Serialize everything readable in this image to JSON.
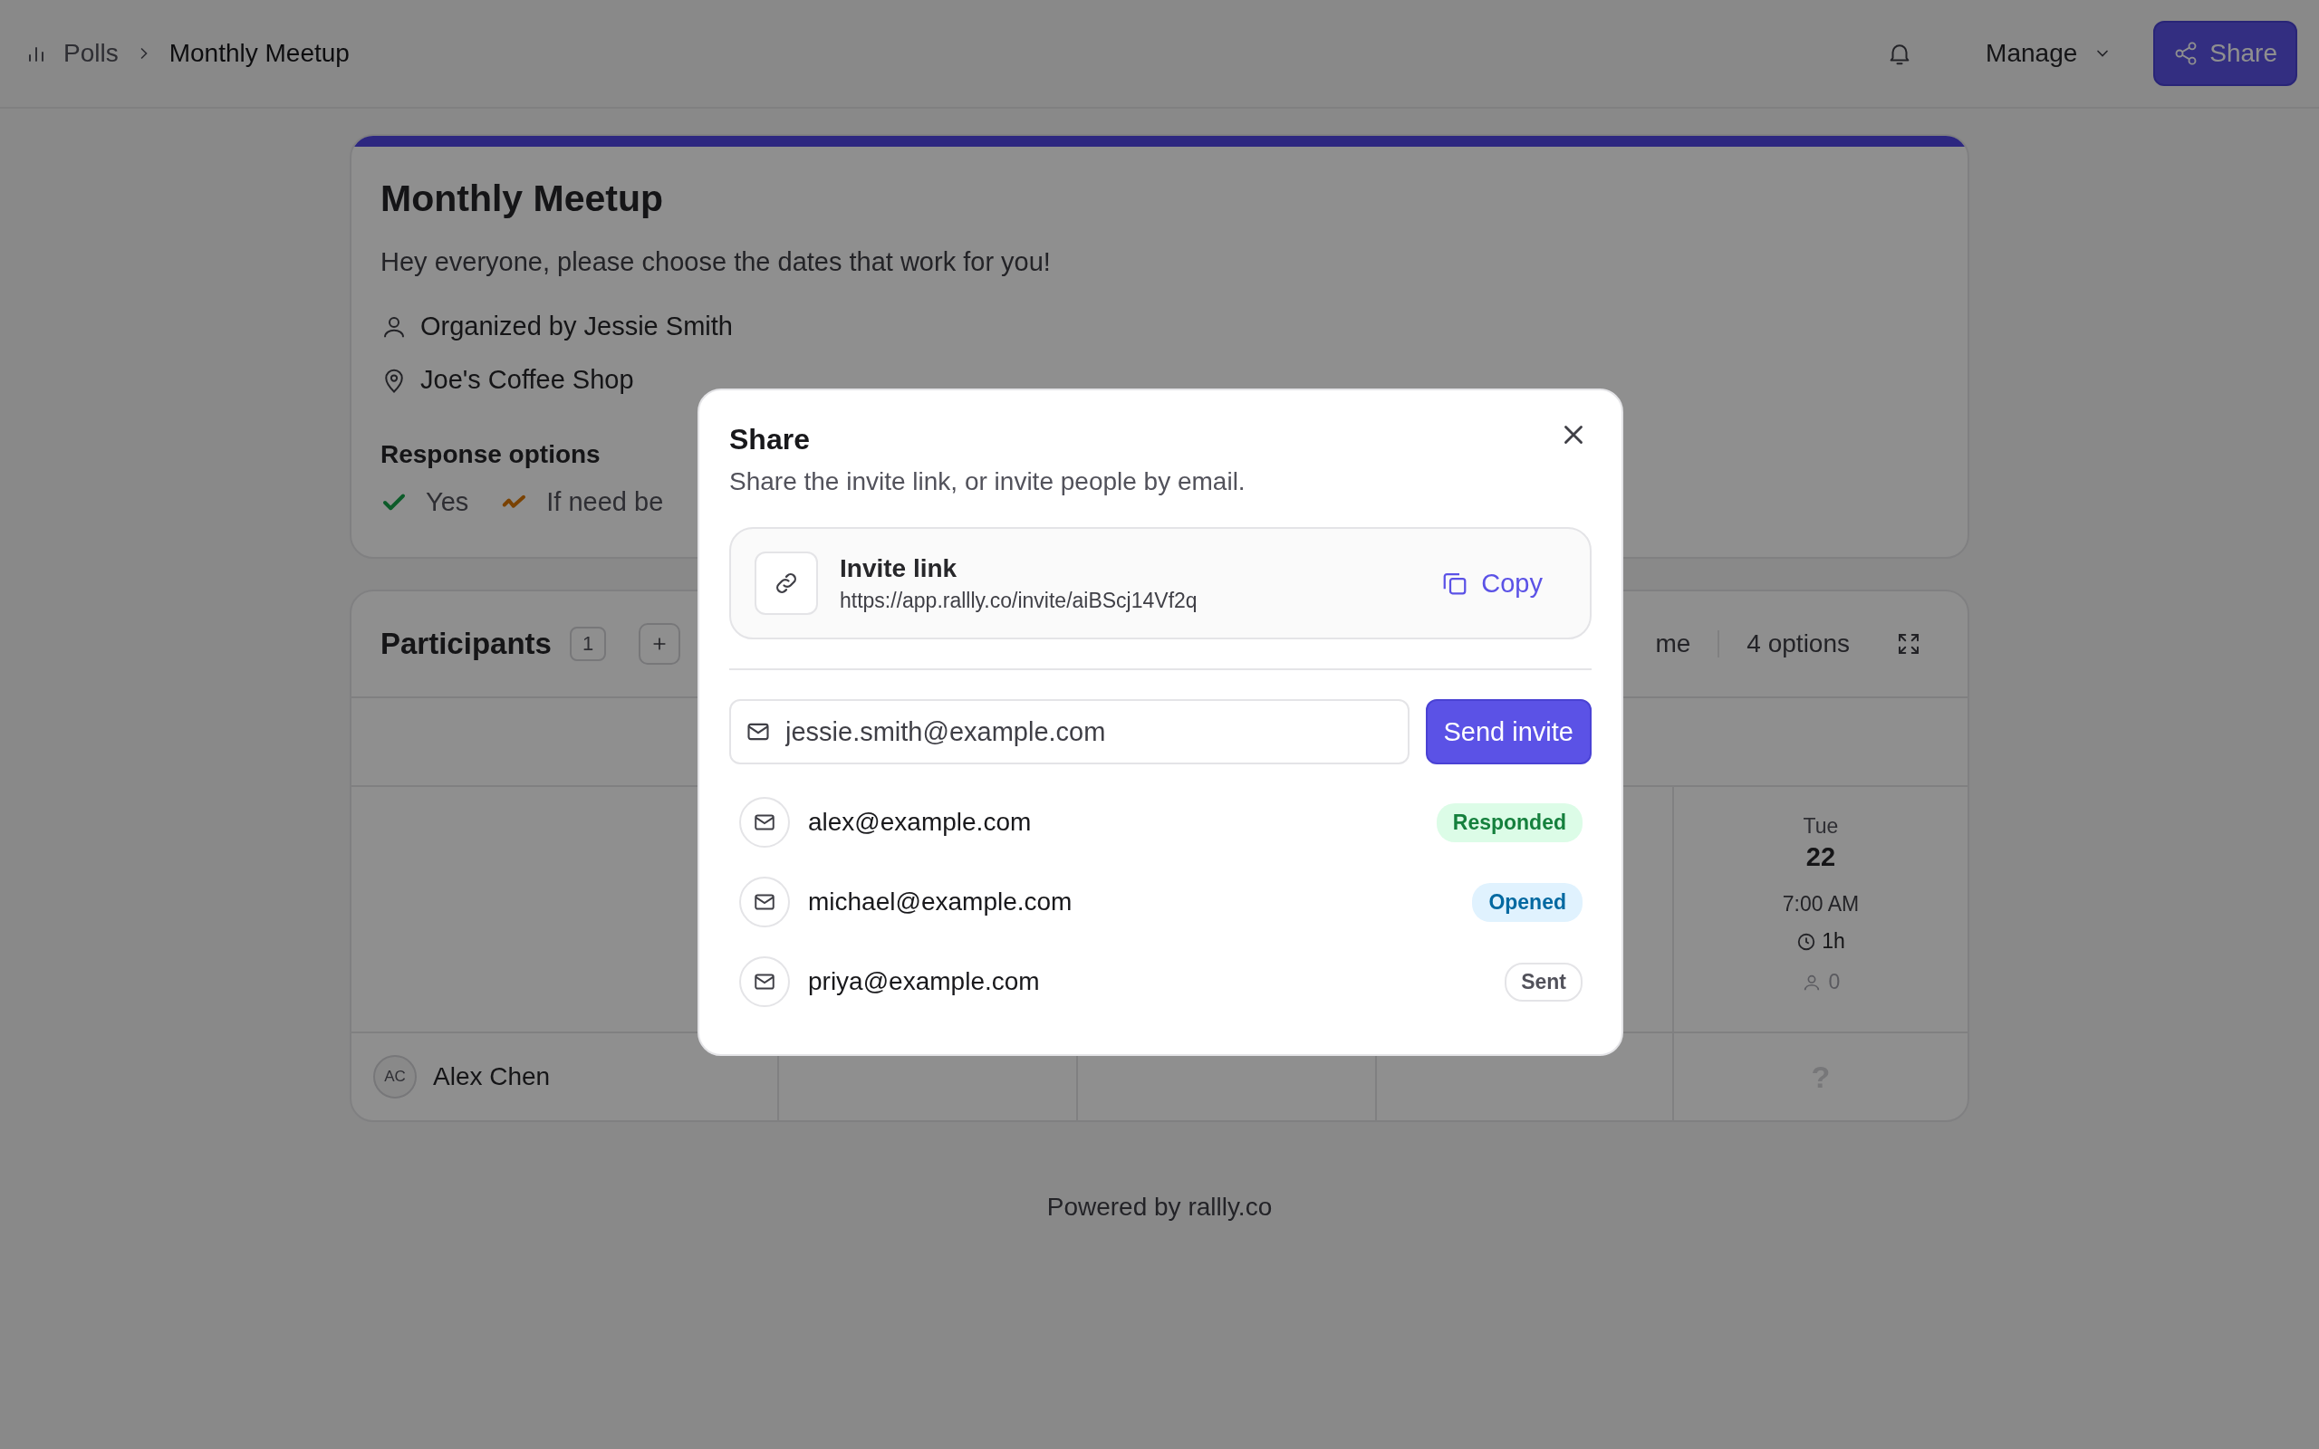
{
  "breadcrumb": [
    {
      "label": "Polls"
    },
    {
      "label": "Monthly Meetup"
    }
  ],
  "header_actions": {
    "manage": "Manage",
    "share": "Share"
  },
  "poll": {
    "title": "Monthly Meetup",
    "description": "Hey everyone, please choose the dates that work for you!",
    "organizer": "Organized by Jessie Smith",
    "location": "Joe's Coffee Shop",
    "response_options_title": "Response options",
    "response_options": [
      {
        "kind": "yes",
        "label": "Yes"
      },
      {
        "kind": "ifneedbe",
        "label": "If need be"
      }
    ]
  },
  "participants": {
    "title": "Participants",
    "count": "1",
    "toolbar_partial": "me",
    "options": "4 options",
    "option_columns": [
      {
        "weekday": "Tue",
        "day": "22",
        "time": "7:00 AM",
        "duration": "1h",
        "votes": "0"
      }
    ],
    "rows": [
      {
        "initials": "AC",
        "name": "Alex Chen",
        "votes": [
          "?"
        ]
      }
    ]
  },
  "footer": "Powered by rallly.co",
  "dialog": {
    "title": "Share",
    "description": "Share the invite link, or invite people by email.",
    "invite_link": {
      "label": "Invite link",
      "url": "https://app.rallly.co/invite/aiBScj14Vf2q",
      "copy": "Copy"
    },
    "email_field": {
      "value": "jessie.smith@example.com"
    },
    "send_button": "Send invite",
    "invites": [
      {
        "email": "alex@example.com",
        "status": "Responded",
        "kind": "responded"
      },
      {
        "email": "michael@example.com",
        "status": "Opened",
        "kind": "opened"
      },
      {
        "email": "priya@example.com",
        "status": "Sent",
        "kind": "sent"
      }
    ]
  }
}
